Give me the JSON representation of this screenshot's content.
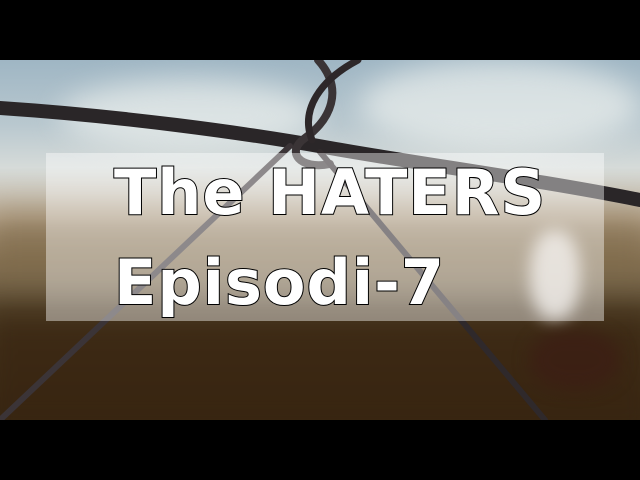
{
  "overlay": {
    "title": "The HATERS",
    "episode": "Episodi-7"
  },
  "colors": {
    "letterbox": "#000000",
    "title_fill": "#ffffff",
    "title_outline": "#000000",
    "panel": "rgba(255,255,255,0.42)"
  }
}
